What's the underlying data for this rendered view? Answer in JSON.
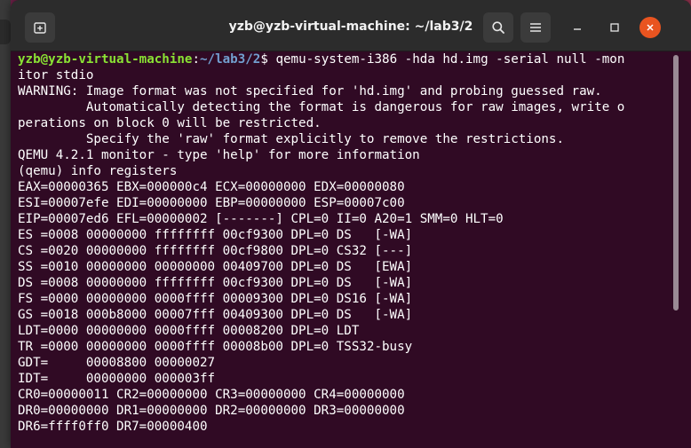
{
  "window": {
    "title": "yzb@yzb-virtual-machine: ~/lab3/2"
  },
  "colors": {
    "terminal_bg": "#300a24",
    "prompt_user": "#8ae234",
    "prompt_path": "#729fcf",
    "close_button": "#e95420",
    "titlebar": "#2c2c2c"
  },
  "icons": {
    "new_tab": "new-tab-icon",
    "search": "search-icon",
    "menu": "hamburger-menu-icon",
    "minimize": "minimize-icon",
    "maximize": "maximize-icon",
    "close": "close-icon"
  },
  "terminal": {
    "prompt_user": "yzb@yzb-virtual-machine",
    "prompt_colon": ":",
    "prompt_path": "~/lab3/2",
    "prompt_sign": "$ ",
    "command": "qemu-system-i386 -hda hd.img -serial null -mon",
    "lines": [
      "itor stdio",
      "WARNING: Image format was not specified for 'hd.img' and probing guessed raw.",
      "         Automatically detecting the format is dangerous for raw images, write o",
      "perations on block 0 will be restricted.",
      "         Specify the 'raw' format explicitly to remove the restrictions.",
      "QEMU 4.2.1 monitor - type 'help' for more information",
      "(qemu) info registers",
      "EAX=00000365 EBX=000000c4 ECX=00000000 EDX=00000080",
      "ESI=00007efe EDI=00000000 EBP=00000000 ESP=00007c00",
      "EIP=00007ed6 EFL=00000002 [-------] CPL=0 II=0 A20=1 SMM=0 HLT=0",
      "ES =0008 00000000 ffffffff 00cf9300 DPL=0 DS   [-WA]",
      "CS =0020 00000000 ffffffff 00cf9800 DPL=0 CS32 [---]",
      "SS =0010 00000000 00000000 00409700 DPL=0 DS   [EWA]",
      "DS =0008 00000000 ffffffff 00cf9300 DPL=0 DS   [-WA]",
      "FS =0000 00000000 0000ffff 00009300 DPL=0 DS16 [-WA]",
      "GS =0018 000b8000 00007fff 00409300 DPL=0 DS   [-WA]",
      "LDT=0000 00000000 0000ffff 00008200 DPL=0 LDT",
      "TR =0000 00000000 0000ffff 00008b00 DPL=0 TSS32-busy",
      "GDT=     00008800 00000027",
      "IDT=     00000000 000003ff",
      "CR0=00000011 CR2=00000000 CR3=00000000 CR4=00000000",
      "DR0=00000000 DR1=00000000 DR2=00000000 DR3=00000000",
      "DR6=ffff0ff0 DR7=00000400"
    ]
  }
}
